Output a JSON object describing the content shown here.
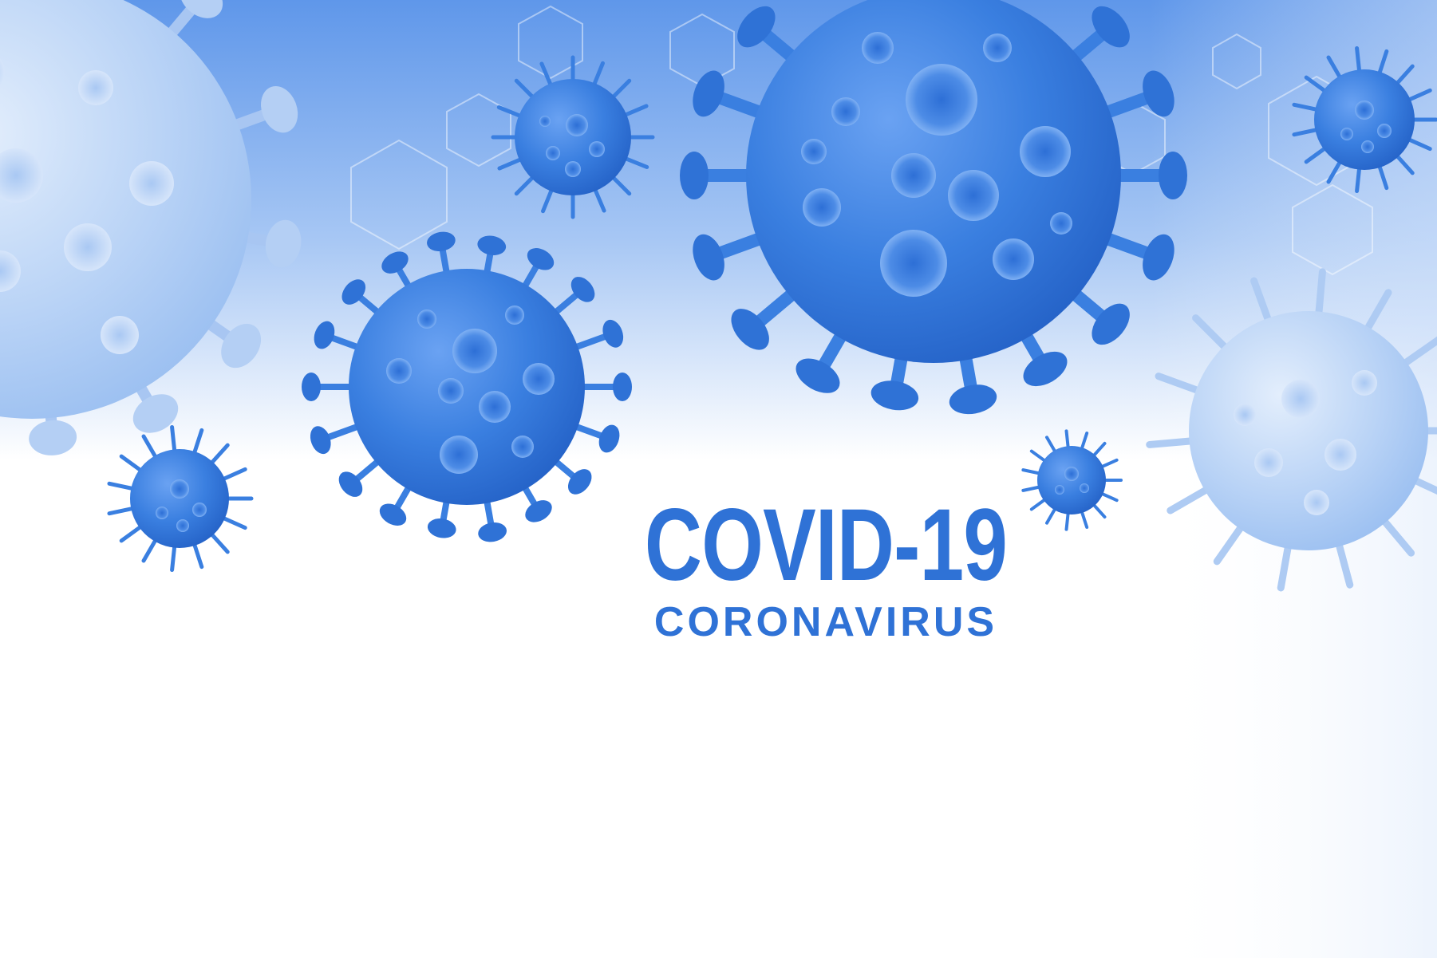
{
  "poster": {
    "title": "COVID-19",
    "subtitle": "CORONAVIRUS"
  },
  "colors": {
    "accent": "#2f72d6",
    "virus_core": "#3a7fe0",
    "virus_dark": "#1f5fc4",
    "virus_faded": "#9cc0f1",
    "background_top": "#6fa4ee",
    "background_bottom": "#ffffff"
  },
  "icons": [
    "virus-icon",
    "hexagon-icon"
  ]
}
